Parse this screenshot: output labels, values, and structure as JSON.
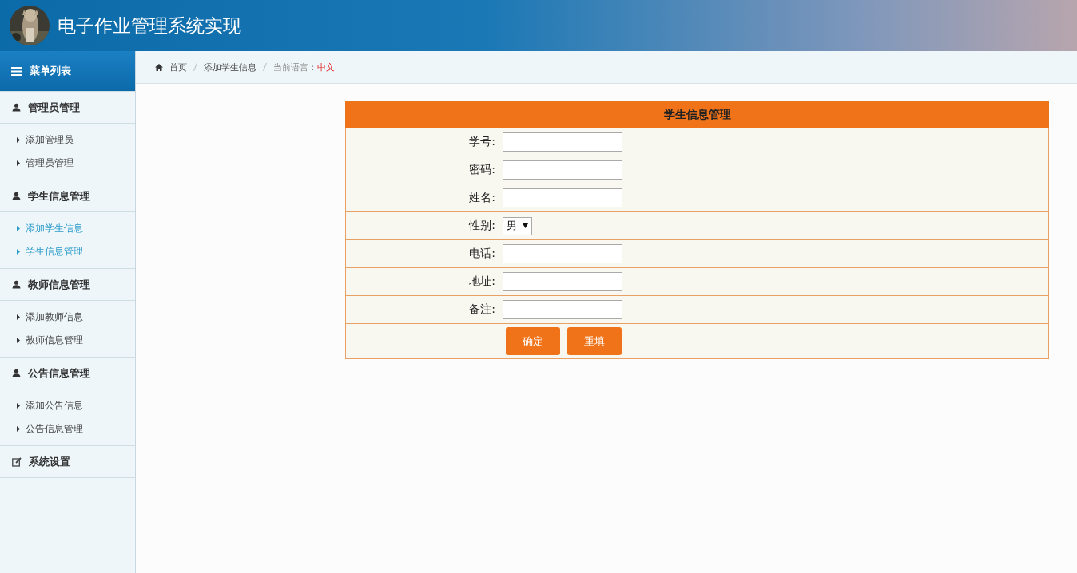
{
  "header": {
    "title": "电子作业管理系统实现"
  },
  "sidebar": {
    "title": "菜单列表",
    "groups": [
      {
        "label": "管理员管理",
        "items": [
          {
            "label": "添加管理员",
            "active": false
          },
          {
            "label": "管理员管理",
            "active": false
          }
        ]
      },
      {
        "label": "学生信息管理",
        "items": [
          {
            "label": "添加学生信息",
            "active": true
          },
          {
            "label": "学生信息管理",
            "active": true
          }
        ]
      },
      {
        "label": "教师信息管理",
        "items": [
          {
            "label": "添加教师信息",
            "active": false
          },
          {
            "label": "教师信息管理",
            "active": false
          }
        ]
      },
      {
        "label": "公告信息管理",
        "items": [
          {
            "label": "添加公告信息",
            "active": false
          },
          {
            "label": "公告信息管理",
            "active": false
          }
        ]
      },
      {
        "label": "系统设置"
      }
    ]
  },
  "breadcrumb": {
    "items": [
      "首页",
      "添加学生信息"
    ],
    "language_label": "当前语言：",
    "language": "中文"
  },
  "form": {
    "title": "学生信息管理",
    "fields": [
      {
        "kind": "text",
        "label": "学号:"
      },
      {
        "kind": "text",
        "label": "密码:"
      },
      {
        "kind": "text",
        "label": "姓名:"
      },
      {
        "kind": "select",
        "label": "性别:",
        "value": "男"
      },
      {
        "kind": "text",
        "label": "电话:"
      },
      {
        "kind": "text",
        "label": "地址:"
      },
      {
        "kind": "text",
        "label": "备注:"
      }
    ],
    "buttons": [
      "确定",
      "重填"
    ]
  }
}
